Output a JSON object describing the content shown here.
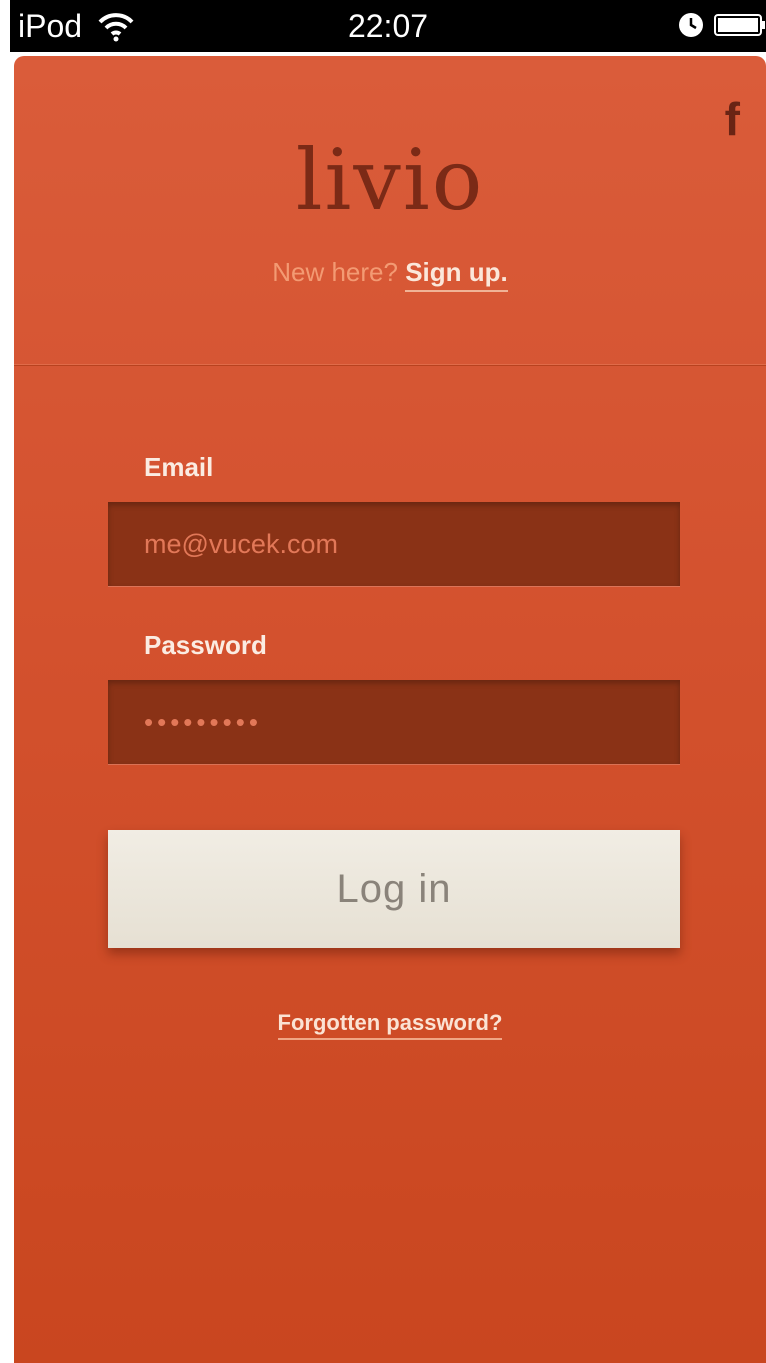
{
  "status_bar": {
    "carrier": "iPod",
    "time": "22:07",
    "icons": [
      "wifi-icon",
      "alarm-icon",
      "battery-icon"
    ]
  },
  "header": {
    "facebook_icon": "f",
    "logo": "livio",
    "signup_prompt": "New here?",
    "signup_link": "Sign up."
  },
  "form": {
    "email_label": "Email",
    "email_value": "me@vucek.com",
    "password_label": "Password",
    "password_value": "•••••••••",
    "login_button": "Log in",
    "forgot_link": "Forgotten password?"
  },
  "colors": {
    "background": "#d4522f",
    "field": "#8a3216",
    "button": "#ece7dc",
    "logo": "#7b2a16"
  }
}
